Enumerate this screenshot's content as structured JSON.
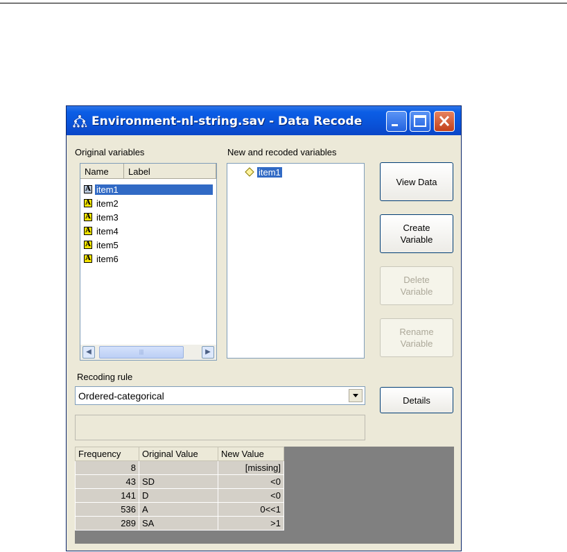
{
  "window": {
    "title": "Environment-nl-string.sav - Data Recode"
  },
  "original_variables": {
    "label": "Original variables",
    "columns": [
      "Name",
      "Label"
    ],
    "items": [
      "item1",
      "item2",
      "item3",
      "item4",
      "item5",
      "item6"
    ],
    "selected": "item1"
  },
  "new_variables": {
    "label": "New and recoded variables",
    "items": [
      "item1"
    ]
  },
  "buttons": {
    "view_data": "View Data",
    "create_variable": "Create\nVariable",
    "delete_variable": "Delete\nVariable",
    "rename_variable": "Rename\nVariable",
    "details": "Details"
  },
  "recoding_rule": {
    "label": "Recoding rule",
    "value": "Ordered-categorical"
  },
  "frequency_table": {
    "columns": [
      "Frequency",
      "Original Value",
      "New Value"
    ],
    "rows": [
      {
        "frequency": "8",
        "original": "",
        "new": "[missing]"
      },
      {
        "frequency": "43",
        "original": "SD",
        "new": "<0"
      },
      {
        "frequency": "141",
        "original": "D",
        "new": "<0"
      },
      {
        "frequency": "536",
        "original": "A",
        "new": "0<<1"
      },
      {
        "frequency": "289",
        "original": "SA",
        "new": ">1"
      }
    ]
  }
}
